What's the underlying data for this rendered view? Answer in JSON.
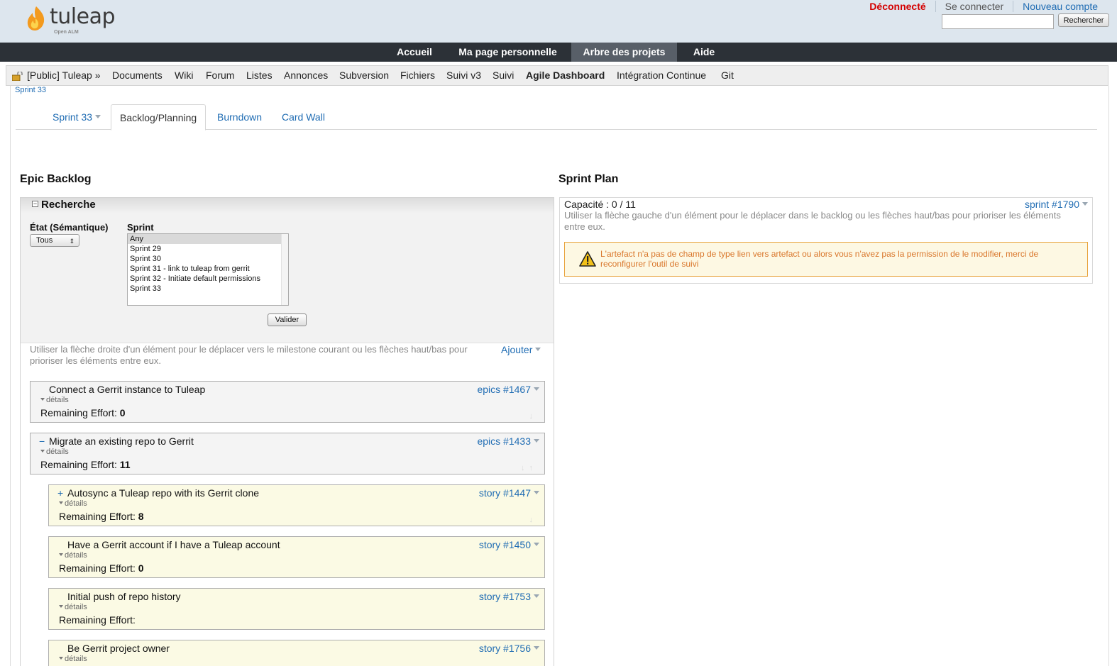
{
  "header": {
    "logo_text": "tuleap",
    "logo_sub": "Open ALM",
    "links": {
      "logout": "Déconnecté",
      "login": "Se connecter",
      "new_account": "Nouveau compte"
    },
    "search_button": "Rechercher",
    "search_value": ""
  },
  "main_nav": {
    "items": [
      {
        "label": "Accueil"
      },
      {
        "label": "Ma page personnelle"
      },
      {
        "label": "Arbre des projets",
        "active": true
      },
      {
        "label": "Aide"
      }
    ]
  },
  "project_nav": {
    "project": "[Public] Tuleap »",
    "items": [
      {
        "label": "Documents"
      },
      {
        "label": "Wiki"
      },
      {
        "label": "Forum"
      },
      {
        "label": "Listes"
      },
      {
        "label": "Annonces"
      },
      {
        "label": "Subversion"
      },
      {
        "label": "Fichiers"
      },
      {
        "label": "Suivi v3"
      },
      {
        "label": "Suivi"
      },
      {
        "label": "Agile Dashboard",
        "active": true
      },
      {
        "label": "Intégration Continue"
      },
      {
        "label": "Git"
      }
    ]
  },
  "breadcrumb": "Sprint 33",
  "tabs": [
    {
      "label": "Sprint 33",
      "dropdown": true
    },
    {
      "label": "Backlog/Planning",
      "active": true
    },
    {
      "label": "Burndown"
    },
    {
      "label": "Card Wall"
    }
  ],
  "left": {
    "title": "Epic Backlog",
    "search": {
      "toggle": "−",
      "title": "Recherche",
      "etat_label": "État (Sémantique)",
      "etat_value": "Tous",
      "sprint_label": "Sprint",
      "sprint_options": [
        "Any",
        "Sprint 29",
        "Sprint 30",
        "Sprint 31 - link to tuleap from gerrit",
        "Sprint 32 - Initiate default permissions",
        "Sprint 33"
      ],
      "sprint_selected": "Any",
      "submit": "Valider"
    },
    "help": "Utiliser la flèche droite d'un élément pour le déplacer vers le milestone courant ou les flèches haut/bas pour prioriser les éléments entre eux.",
    "add": "Ajouter",
    "details_label": "détails",
    "effort_label": "Remaining Effort:",
    "items": [
      {
        "title": "Connect a Gerrit instance to Tuleap",
        "id": "epics #1467",
        "effort": "0",
        "toggle": ""
      },
      {
        "title": "Migrate an existing repo to Gerrit",
        "id": "epics #1433",
        "effort": "11",
        "toggle": "−"
      },
      {
        "title": "Autosync a Tuleap repo with its Gerrit clone",
        "id": "story #1447",
        "effort": "8",
        "toggle": "+"
      },
      {
        "title": "Have a Gerrit account if I have a Tuleap account",
        "id": "story #1450",
        "effort": "0",
        "toggle": ""
      },
      {
        "title": "Initial push of repo history",
        "id": "story #1753",
        "effort": "",
        "toggle": ""
      },
      {
        "title": "Be Gerrit project owner",
        "id": "story #1756",
        "effort": "",
        "toggle": ""
      }
    ]
  },
  "right": {
    "title": "Sprint Plan",
    "capacity": "Capacité : 0 / 11",
    "sprint_link": "sprint #1790",
    "help": "Utiliser la flèche gauche d'un élément pour le déplacer dans le backlog ou les flèches haut/bas pour prioriser les éléments entre eux.",
    "warning": "L'artefact n'a pas de champ de type lien vers artefact ou alors vous n'avez pas la permission de le modifier, merci de reconfigurer l'outil de suivi"
  },
  "colors": {
    "nav_bg": "#2c3137",
    "nav_active": "#585f68",
    "header_bg": "#dde6ee",
    "link": "#1f6cb3",
    "logout": "#d40000",
    "warning": "#d9762b",
    "story_bg": "#fbfae4"
  }
}
